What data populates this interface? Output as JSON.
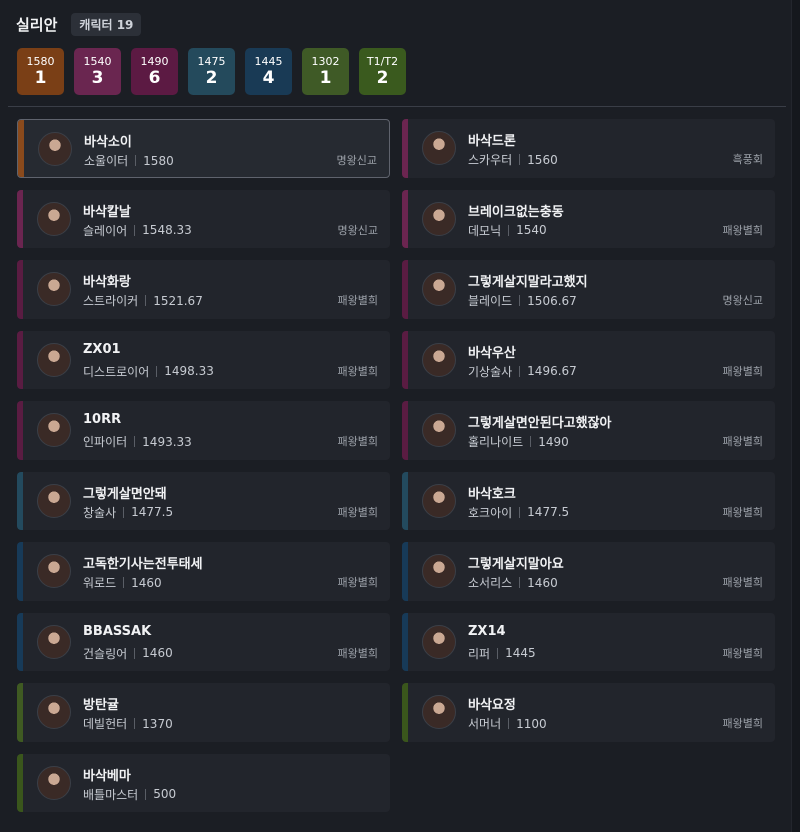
{
  "header": {
    "server_name": "실리안",
    "character_count": "캐릭터 19"
  },
  "level_summary": [
    {
      "level": "1580",
      "count": "1",
      "color": "#7a3f16"
    },
    {
      "level": "1540",
      "count": "3",
      "color": "#6a2650"
    },
    {
      "level": "1490",
      "count": "6",
      "color": "#5c1a43"
    },
    {
      "level": "1475",
      "count": "2",
      "color": "#244a5c"
    },
    {
      "level": "1445",
      "count": "4",
      "color": "#193a55"
    },
    {
      "level": "1302",
      "count": "1",
      "color": "#3f5a26"
    },
    {
      "level": "T1/T2",
      "count": "2",
      "color": "#3a5a1e"
    }
  ],
  "characters": [
    {
      "name": "바삭소이",
      "class": "소울이터",
      "item_level": "1580",
      "guild": "명왕신교",
      "accent": "#8a4a1c",
      "selected": true
    },
    {
      "name": "바삭드론",
      "class": "스카우터",
      "item_level": "1560",
      "guild": "흑풍회",
      "accent": "#6b2550"
    },
    {
      "name": "바삭칼날",
      "class": "슬레이어",
      "item_level": "1548.33",
      "guild": "명왕신교",
      "accent": "#6b2550"
    },
    {
      "name": "브레이크없는충동",
      "class": "데모닉",
      "item_level": "1540",
      "guild": "패왕별희",
      "accent": "#6b2550"
    },
    {
      "name": "바삭화랑",
      "class": "스트라이커",
      "item_level": "1521.67",
      "guild": "패왕별희",
      "accent": "#5a1c42"
    },
    {
      "name": "그렇게살지말라고했지",
      "class": "블레이드",
      "item_level": "1506.67",
      "guild": "명왕신교",
      "accent": "#5a1c42"
    },
    {
      "name": "ZX01",
      "class": "디스트로이어",
      "item_level": "1498.33",
      "guild": "패왕별희",
      "accent": "#5a1c42"
    },
    {
      "name": "바삭우산",
      "class": "기상술사",
      "item_level": "1496.67",
      "guild": "패왕별희",
      "accent": "#5a1c42"
    },
    {
      "name": "10RR",
      "class": "인파이터",
      "item_level": "1493.33",
      "guild": "패왕별희",
      "accent": "#5a1c42"
    },
    {
      "name": "그렇게살면안된다고했잖아",
      "class": "홀리나이트",
      "item_level": "1490",
      "guild": "패왕별희",
      "accent": "#5a1c42"
    },
    {
      "name": "그렇게살면안돼",
      "class": "창술사",
      "item_level": "1477.5",
      "guild": "패왕별희",
      "accent": "#234a5e"
    },
    {
      "name": "바삭호크",
      "class": "호크아이",
      "item_level": "1477.5",
      "guild": "패왕별희",
      "accent": "#234a5e"
    },
    {
      "name": "고독한기사는전투태세",
      "class": "워로드",
      "item_level": "1460",
      "guild": "패왕별희",
      "accent": "#173a58"
    },
    {
      "name": "그렇게살지말아요",
      "class": "소서리스",
      "item_level": "1460",
      "guild": "패왕별희",
      "accent": "#173a58"
    },
    {
      "name": "BBASSAK",
      "class": "건슬링어",
      "item_level": "1460",
      "guild": "패왕별희",
      "accent": "#173a58"
    },
    {
      "name": "ZX14",
      "class": "리퍼",
      "item_level": "1445",
      "guild": "패왕별희",
      "accent": "#173a58"
    },
    {
      "name": "방탄귤",
      "class": "데빌헌터",
      "item_level": "1370",
      "guild": "",
      "accent": "#3f5a22"
    },
    {
      "name": "바삭요정",
      "class": "서머너",
      "item_level": "1100",
      "guild": "패왕별희",
      "accent": "#3a561c"
    },
    {
      "name": "바삭베마",
      "class": "배틀마스터",
      "item_level": "500",
      "guild": "",
      "accent": "#3a561c"
    }
  ]
}
